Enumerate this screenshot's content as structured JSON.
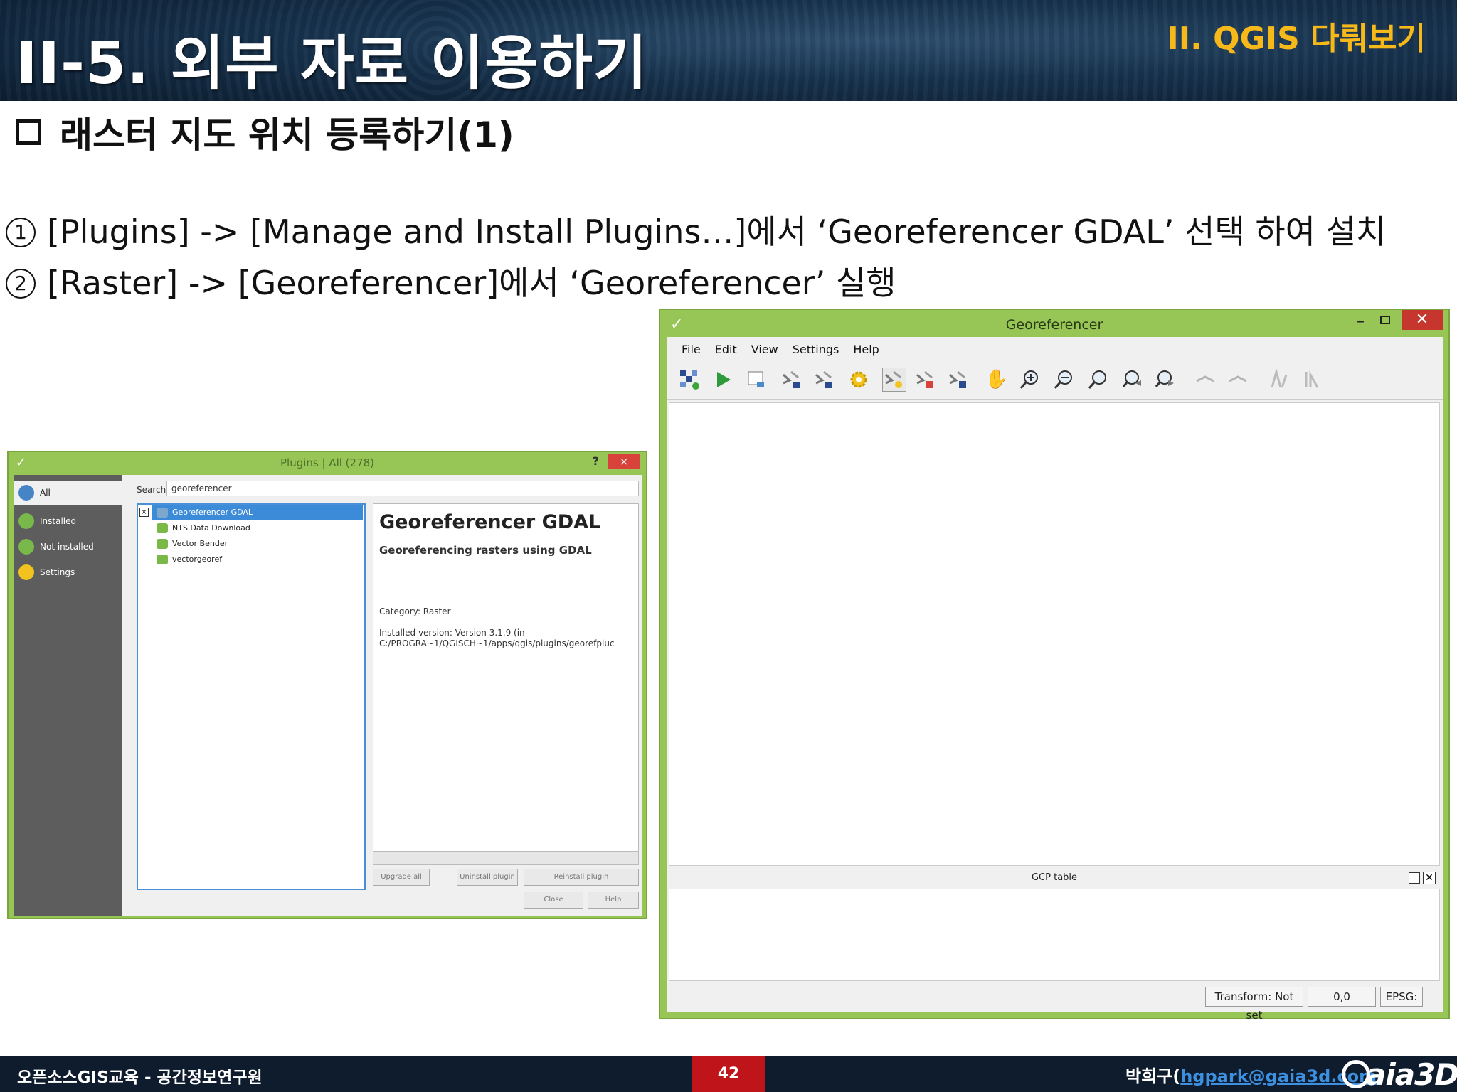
{
  "header": {
    "title": "II-5. 외부 자료 이용하기",
    "section": "II. QGIS 다뤄보기"
  },
  "subtitle": "래스터 지도 위치 등록하기(1)",
  "steps": [
    {
      "num": "1",
      "text": "[Plugins] -> [Manage and Install Plugins…]에서 ‘Georeferencer GDAL’ 선택 하여 설치"
    },
    {
      "num": "2",
      "text": "[Raster] -> [Georeferencer]에서 ‘Georeferencer’ 실행"
    }
  ],
  "plugins_window": {
    "title": "Plugins | All (278)",
    "help": "?",
    "close": "×",
    "nav": [
      "All",
      "Installed",
      "Not installed",
      "Settings"
    ],
    "search_label": "Search",
    "search_value": "georeferencer",
    "list": [
      "Georeferencer GDAL",
      "NTS Data Download",
      "Vector Bender",
      "vectorgeoref"
    ],
    "detail": {
      "title": "Georeferencer GDAL",
      "description": "Georeferencing rasters using GDAL",
      "category": "Category: Raster",
      "installed_line1": "Installed version: Version 3.1.9 (in",
      "installed_line2": "C:/PROGRA~1/QGISCH~1/apps/qgis/plugins/georefpluc"
    },
    "buttons": [
      "Upgrade all",
      "Uninstall plugin",
      "Reinstall plugin",
      "Close",
      "Help"
    ]
  },
  "georeferencer_window": {
    "title": "Georeferencer",
    "menu": [
      "File",
      "Edit",
      "View",
      "Settings",
      "Help"
    ],
    "toolbar_icons": [
      "open-raster-icon",
      "start-georeferencing-icon",
      "generate-gdal-script-icon",
      "load-gcp-icon",
      "save-gcp-icon",
      "transformation-settings-icon",
      "add-point-icon",
      "delete-point-icon",
      "move-gcp-icon",
      "pan-icon",
      "zoom-in-icon",
      "zoom-out-icon",
      "zoom-to-layer-icon",
      "zoom-last-icon",
      "zoom-next-icon",
      "link-georeferencer-icon",
      "link-qgis-icon",
      "full-histogram-stretch-icon",
      "local-histogram-stretch-icon"
    ],
    "gcp_table_label": "GCP table",
    "status": {
      "transform": "Transform: Not set",
      "coords": "0,0",
      "epsg": "EPSG:"
    }
  },
  "footer": {
    "org": "오픈소스GIS교육 - 공간정보연구원",
    "page": "42",
    "author": "박희구(",
    "email": "hgpark@gaia3d.com",
    "author_end": ")",
    "logo": "aia3D"
  },
  "colors": {
    "header_bg": "#17324d",
    "section_label": "#f7b81a",
    "window_frame": "#97c656",
    "close_red": "#c7362e",
    "footer_bg": "#0f1c2e",
    "page_box": "#c0141b"
  }
}
